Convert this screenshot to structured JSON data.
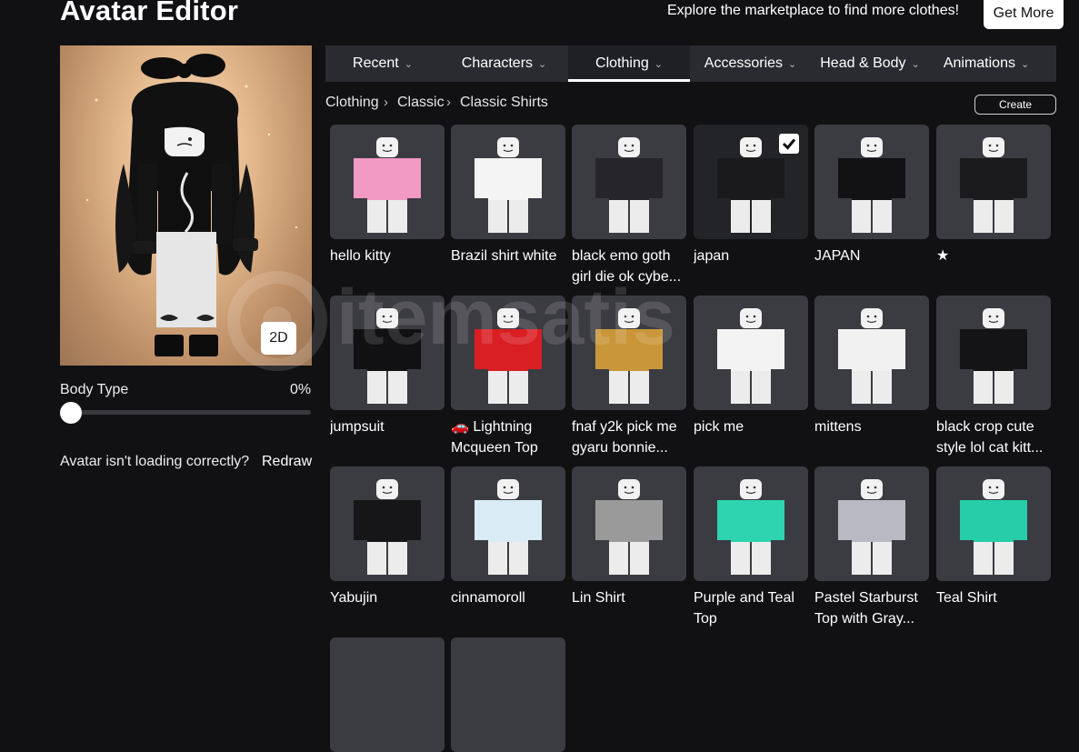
{
  "header": {
    "title": "Avatar Editor",
    "promo_text": "Explore the marketplace to find more clothes!",
    "get_more_label": "Get More"
  },
  "avatar": {
    "view_toggle_label": "2D",
    "body_type_label": "Body Type",
    "body_type_value": "0%",
    "body_type_fraction": 0,
    "loading_text": "Avatar isn't loading correctly?",
    "redraw_label": "Redraw"
  },
  "tabs": [
    {
      "label": "Recent",
      "active": false
    },
    {
      "label": "Characters",
      "active": false
    },
    {
      "label": "Clothing",
      "active": true
    },
    {
      "label": "Accessories",
      "active": false
    },
    {
      "label": "Head & Body",
      "active": false
    },
    {
      "label": "Animations",
      "active": false
    }
  ],
  "breadcrumb": [
    "Clothing",
    "Classic",
    "Classic Shirts"
  ],
  "create_label": "Create",
  "items": [
    {
      "name": "hello kitty",
      "shirt": "#f29ac4",
      "selected": false,
      "icon": "hello-kitty-shirt-icon"
    },
    {
      "name": "Brazil shirt white",
      "shirt": "#f4f4f4",
      "selected": false,
      "icon": "brazil-shirt-icon"
    },
    {
      "name": "black emo goth girl die ok cybe...",
      "shirt": "#26262a",
      "selected": false,
      "icon": "emo-shirt-icon"
    },
    {
      "name": "japan",
      "shirt": "#1a1a1c",
      "selected": true,
      "icon": "japan-shirt-icon"
    },
    {
      "name": "JAPAN",
      "shirt": "#121214",
      "selected": false,
      "icon": "japan-shirt-icon"
    },
    {
      "name": "★",
      "shirt": "#1b1b1d",
      "selected": false,
      "icon": "star-shirt-icon"
    },
    {
      "name": "jumpsuit",
      "shirt": "#111113",
      "selected": false,
      "icon": "jumpsuit-icon"
    },
    {
      "name": "🚗 Lightning Mcqueen Top",
      "shirt": "#d91e24",
      "selected": false,
      "icon": "mcqueen-shirt-icon"
    },
    {
      "name": "fnaf y2k pick me gyaru bonnie...",
      "shirt": "#c9973a",
      "selected": false,
      "icon": "fnaf-shirt-icon"
    },
    {
      "name": "pick me",
      "shirt": "#f3f3f3",
      "selected": false,
      "icon": "pick-me-shirt-icon"
    },
    {
      "name": "mittens",
      "shirt": "#f1f1f1",
      "selected": false,
      "icon": "mittens-shirt-icon"
    },
    {
      "name": "black crop cute style lol cat kitt...",
      "shirt": "#141416",
      "selected": false,
      "icon": "cat-crop-shirt-icon"
    },
    {
      "name": "Yabujin",
      "shirt": "#161618",
      "selected": false,
      "icon": "yabujin-shirt-icon"
    },
    {
      "name": "cinnamoroll",
      "shirt": "#d9ecf6",
      "selected": false,
      "icon": "cinnamoroll-shirt-icon"
    },
    {
      "name": "Lin Shirt",
      "shirt": "#9a9a9a",
      "selected": false,
      "icon": "lin-shirt-icon"
    },
    {
      "name": "Purple and Teal Top",
      "shirt": "#2ed3b0",
      "selected": false,
      "icon": "teal-top-icon"
    },
    {
      "name": "Pastel Starburst Top with Gray...",
      "shirt": "#b9b9c3",
      "selected": false,
      "icon": "pastel-top-icon"
    },
    {
      "name": "Teal Shirt",
      "shirt": "#26cda8",
      "selected": false,
      "icon": "teal-shirt-icon"
    }
  ],
  "watermark_text": "itemsatis"
}
